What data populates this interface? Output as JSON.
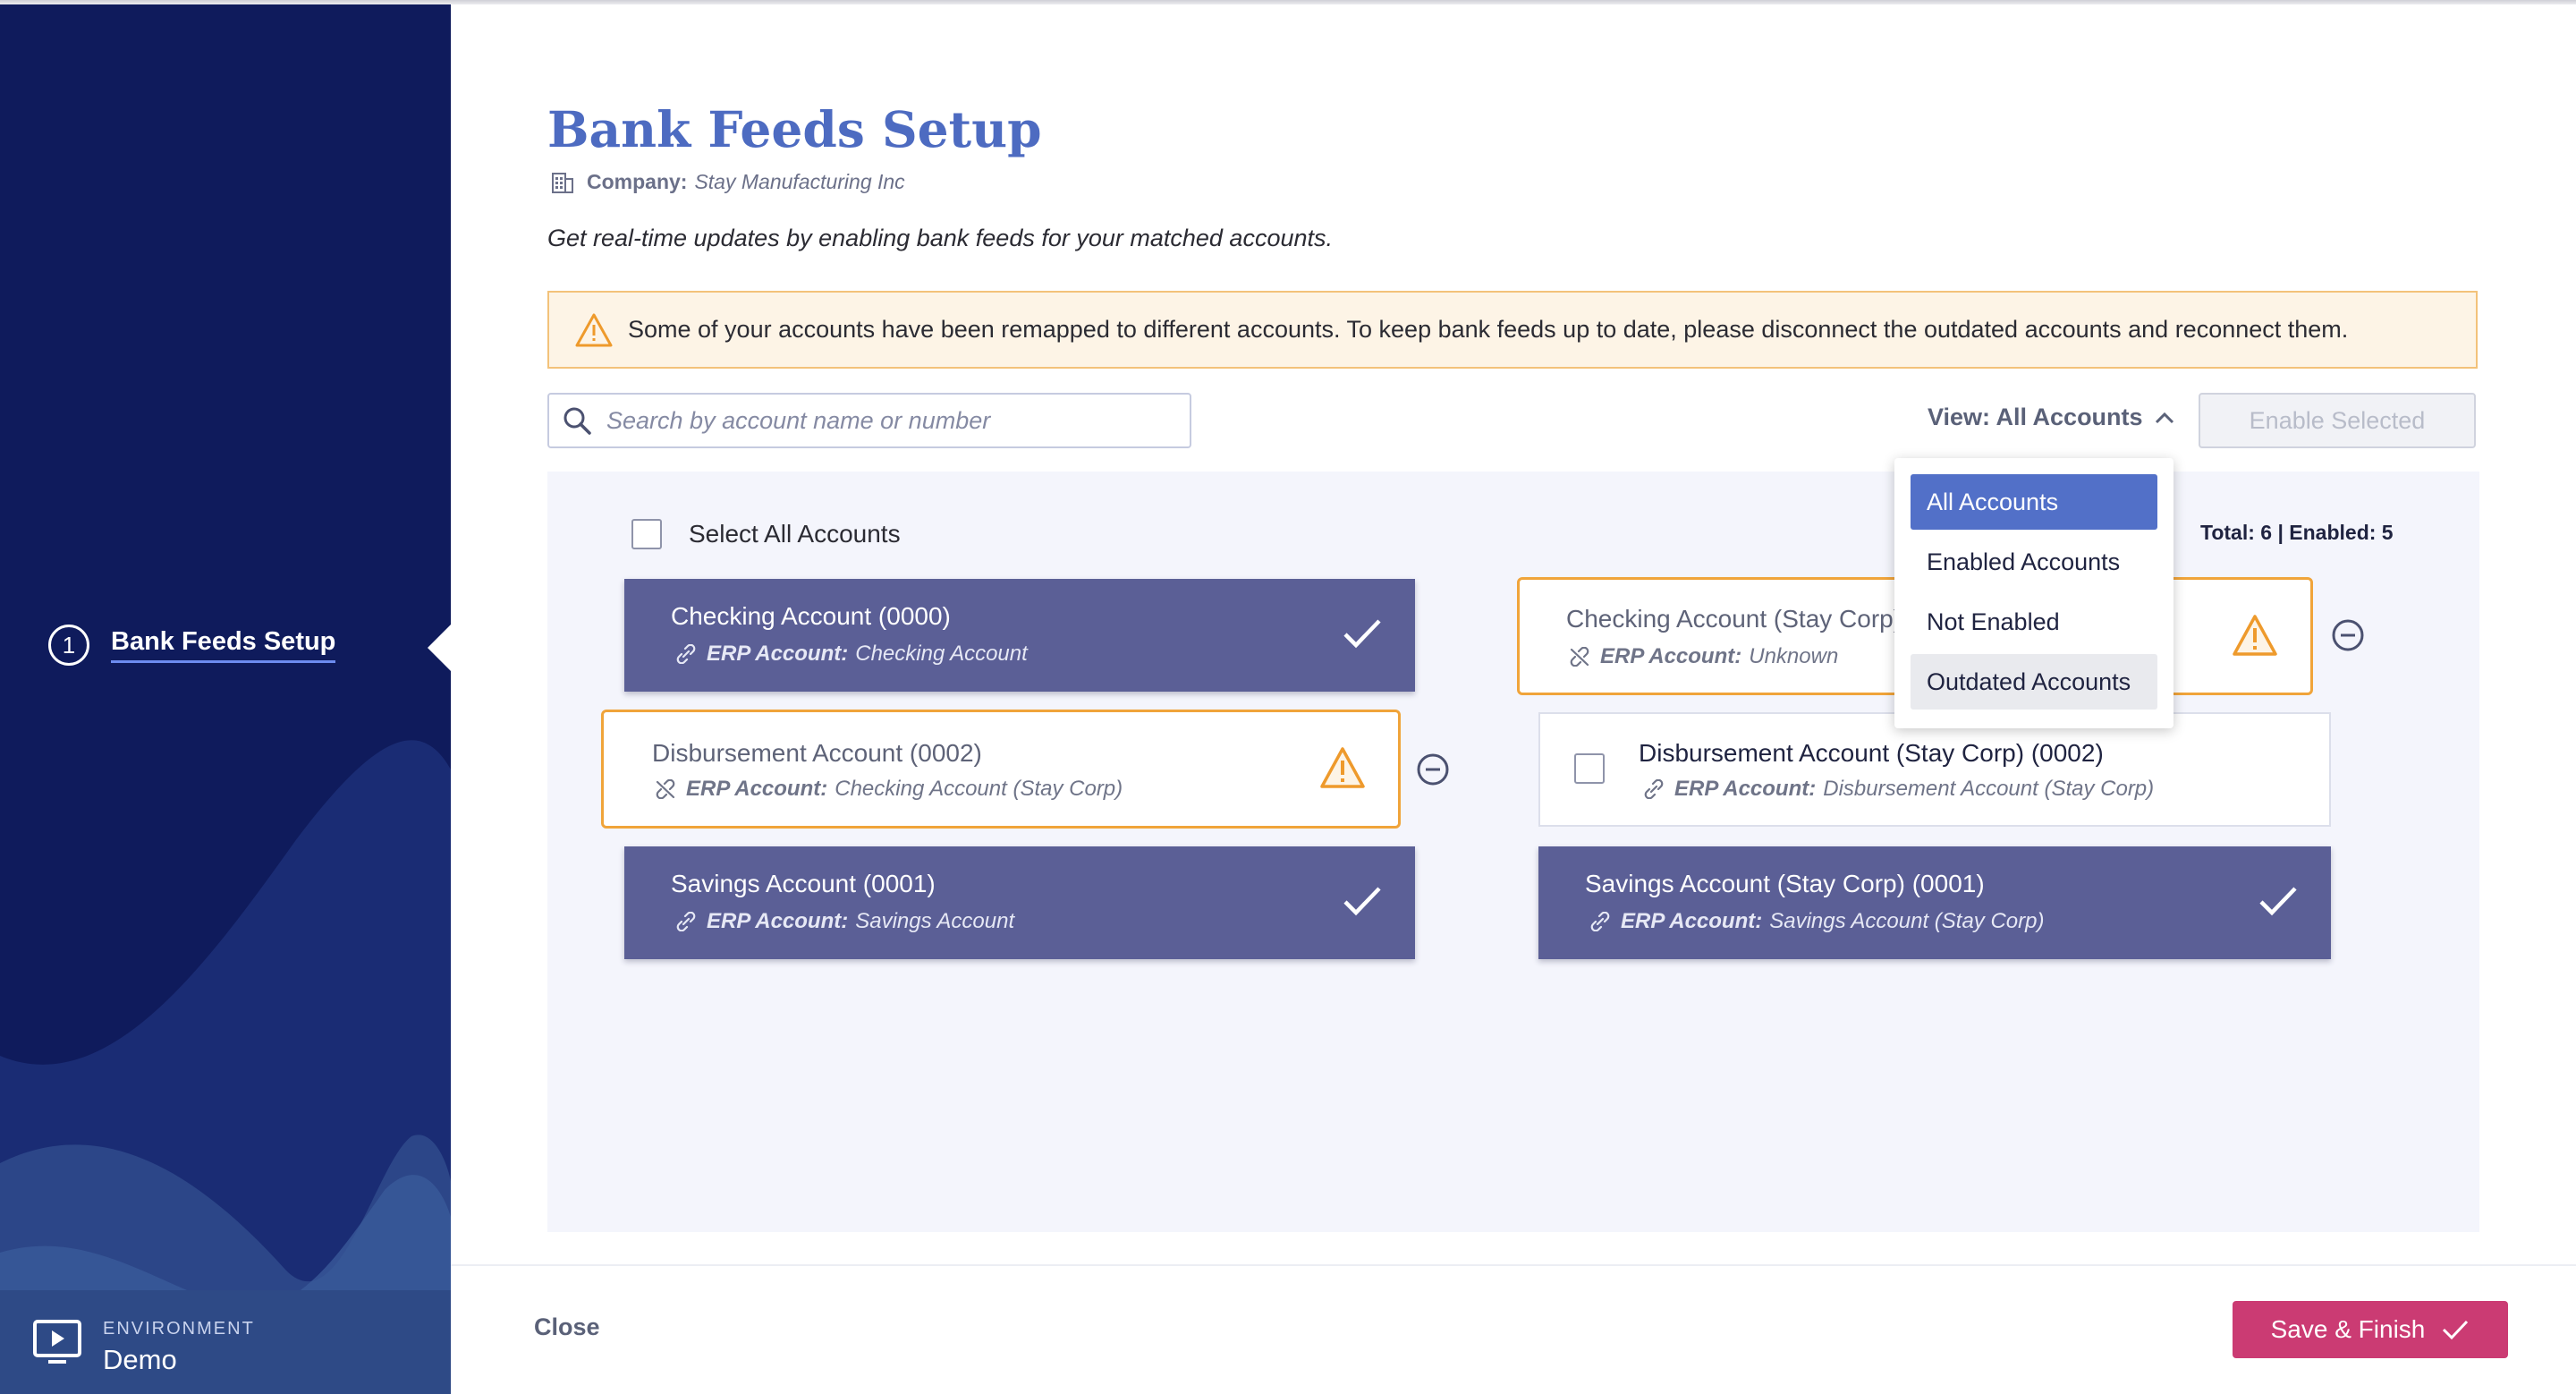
{
  "sidebar": {
    "steps": [
      {
        "number": "1",
        "label": "Bank Feeds Setup"
      }
    ],
    "environment": {
      "caption": "ENVIRONMENT",
      "value": "Demo"
    }
  },
  "header": {
    "title": "Bank Feeds Setup",
    "company_label": "Company:",
    "company_name": "Stay Manufacturing Inc",
    "subtitle": "Get real-time updates by enabling bank feeds for your matched accounts."
  },
  "alert": {
    "text": "Some of your accounts have been remapped to different accounts. To keep bank feeds up to date, please disconnect the outdated accounts and reconnect them."
  },
  "toolbar": {
    "search_placeholder": "Search by account name or number",
    "view_label": "View: All Accounts",
    "enable_selected": "Enable Selected"
  },
  "dropdown": {
    "options": [
      "All Accounts",
      "Enabled Accounts",
      "Not Enabled",
      "Outdated Accounts"
    ],
    "selected": "All Accounts"
  },
  "list": {
    "select_all": "Select All Accounts",
    "totals": "Total: 6  |  Enabled: 5",
    "erp_label": "ERP Account:",
    "accounts": [
      {
        "name": "Checking Account (0000)",
        "erp": "Checking Account",
        "status": "enabled"
      },
      {
        "name": "Checking Account (Stay Corp)",
        "erp": "Unknown",
        "status": "outdated"
      },
      {
        "name": "Disbursement Account (0002)",
        "erp": "Checking Account (Stay Corp)",
        "status": "outdated"
      },
      {
        "name": "Disbursement Account (Stay Corp) (0002)",
        "erp": "Disbursement Account (Stay Corp)",
        "status": "not-enabled"
      },
      {
        "name": "Savings Account (0001)",
        "erp": "Savings Account",
        "status": "enabled"
      },
      {
        "name": "Savings Account (Stay Corp) (0001)",
        "erp": "Savings Account (Stay Corp)",
        "status": "enabled"
      }
    ]
  },
  "footer": {
    "close": "Close",
    "save": "Save & Finish"
  },
  "colors": {
    "sidebar_bg": "#0f1b5c",
    "title": "#4d6bc1",
    "enabled_card": "#5b5f96",
    "warning": "#f0a43a",
    "save_button": "#cb3b73",
    "dropdown_active": "#5270c8"
  },
  "icons": {
    "company": "building-icon",
    "alert": "warning-triangle-icon",
    "search": "search-icon",
    "view": "chevron-up-icon",
    "enabled": "checkmark-icon",
    "outdated": "warning-triangle-icon",
    "remove": "minus-circle-icon",
    "linked": "link-icon",
    "unlinked": "broken-link-icon",
    "environment": "monitor-play-icon"
  }
}
